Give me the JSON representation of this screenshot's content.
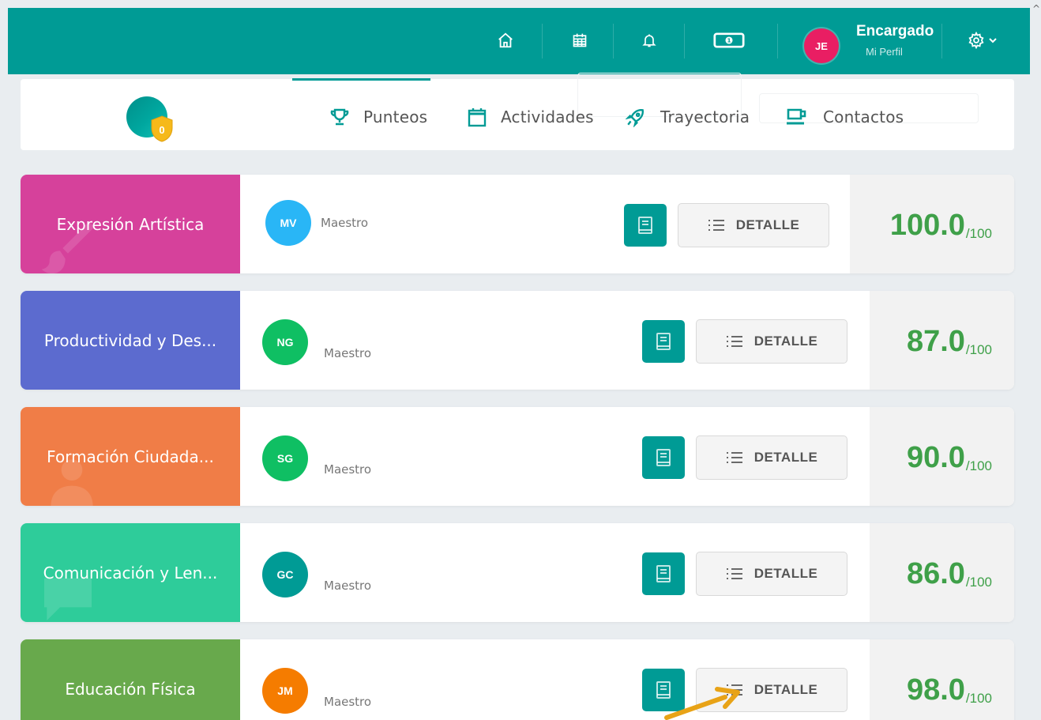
{
  "header": {
    "user_initials": "JE",
    "user_name": "Encargado",
    "user_link": "Mi Perfil",
    "icons": [
      "home-icon",
      "calendar-icon",
      "bell-icon",
      "payments-icon",
      "settings-icon"
    ],
    "brand_color": "#009b95"
  },
  "tabs": [
    {
      "label": "Punteos",
      "icon": "trophy-icon",
      "active": true
    },
    {
      "label": "Actividades",
      "icon": "calendar-icon",
      "active": false
    },
    {
      "label": "Trayectoria",
      "icon": "rocket-icon",
      "active": false
    },
    {
      "label": "Contactos",
      "icon": "cup-icon",
      "active": false
    }
  ],
  "badge": {
    "count": "0"
  },
  "courses": [
    {
      "name": "Expresión Artística",
      "teacher_initials": "MV",
      "teacher_role": "Maestro",
      "detail_label": "DETALLE",
      "score": "100.0",
      "max": "/100",
      "color": "#d6419b",
      "avatar_color": "#29b6f6"
    },
    {
      "name": "Productividad y Des...",
      "teacher_initials": "NG",
      "teacher_role": "Maestro",
      "detail_label": "DETALLE",
      "score": "87.0",
      "max": "/100",
      "color": "#5c6bcf",
      "avatar_color": "#0fbf63"
    },
    {
      "name": "Formación Ciudada...",
      "teacher_initials": "SG",
      "teacher_role": "Maestro",
      "detail_label": "DETALLE",
      "score": "90.0",
      "max": "/100",
      "color": "#f07d47",
      "avatar_color": "#0fbf63"
    },
    {
      "name": "Comunicación y Len...",
      "teacher_initials": "GC",
      "teacher_role": "Maestro",
      "detail_label": "DETALLE",
      "score": "86.0",
      "max": "/100",
      "color": "#2ecc9a",
      "avatar_color": "#009b95"
    },
    {
      "name": "Educación Física",
      "teacher_initials": "JM",
      "teacher_role": "Maestro",
      "detail_label": "DETALLE",
      "score": "98.0",
      "max": "/100",
      "color": "#68a94c",
      "avatar_color": "#f57c00"
    }
  ],
  "score_color": "#3fa049"
}
